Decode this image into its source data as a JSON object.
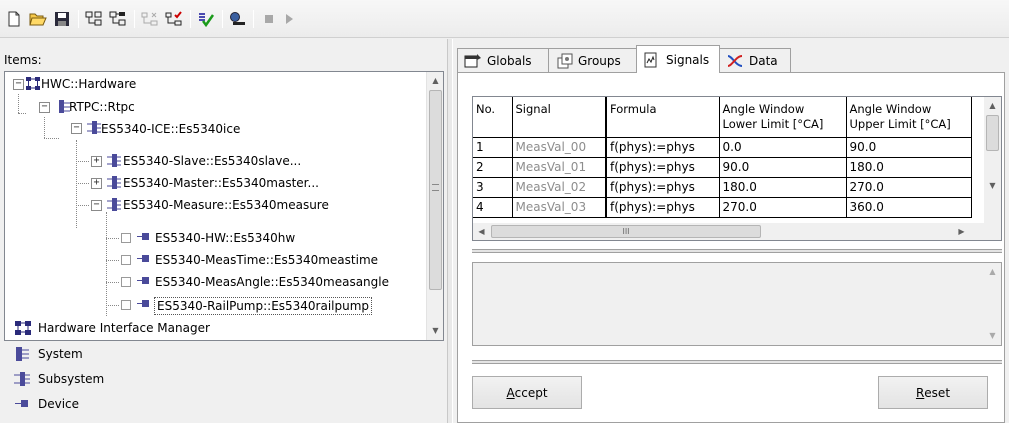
{
  "toolbar": {
    "buttons": [
      "new-icon",
      "open-icon",
      "save-icon",
      "tree-expand-icon",
      "tree-collapse-icon",
      "tree-disabled-icon",
      "tree-check-icon",
      "verify-icon",
      "connect-icon",
      "stop-icon",
      "run-icon"
    ]
  },
  "left": {
    "items_label": "Items:",
    "tree": [
      {
        "label": "HWC::Hardware",
        "level": 0,
        "type": "hardware",
        "expanded": true
      },
      {
        "label": "RTPC::Rtpc",
        "level": 1,
        "type": "system",
        "expanded": true
      },
      {
        "label": "ES5340-ICE::Es5340ice",
        "level": 2,
        "type": "subsystem",
        "expanded": true
      },
      {
        "label": "ES5340-Slave::Es5340slave...",
        "level": 3,
        "type": "subsystem",
        "expanded": false
      },
      {
        "label": "ES5340-Master::Es5340master...",
        "level": 3,
        "type": "subsystem",
        "expanded": false
      },
      {
        "label": "ES5340-Measure::Es5340measure",
        "level": 3,
        "type": "subsystem",
        "expanded": true
      },
      {
        "label": "ES5340-HW::Es5340hw",
        "level": 4,
        "type": "device"
      },
      {
        "label": "ES5340-MeasTime::Es5340meastime",
        "level": 4,
        "type": "device"
      },
      {
        "label": "ES5340-MeasAngle::Es5340measangle",
        "level": 4,
        "type": "device"
      },
      {
        "label": "ES5340-RailPump::Es5340railpump",
        "level": 4,
        "type": "device",
        "selected": true
      }
    ],
    "legend": [
      {
        "label": "Hardware Interface Manager",
        "icon": "hardware-icon"
      },
      {
        "label": "System",
        "icon": "system-icon"
      },
      {
        "label": "Subsystem",
        "icon": "subsystem-icon"
      },
      {
        "label": "Device",
        "icon": "device-icon"
      }
    ]
  },
  "right": {
    "tabs": [
      {
        "label": "Globals",
        "icon": "globals-icon",
        "active": false
      },
      {
        "label": "Groups",
        "icon": "groups-icon",
        "active": false
      },
      {
        "label": "Signals",
        "icon": "signals-icon",
        "active": true
      },
      {
        "label": "Data",
        "icon": "data-icon",
        "active": false
      }
    ],
    "grid": {
      "headers": [
        "No.",
        "Signal",
        "Formula",
        "Angle Window\nLower Limit [°CA]",
        "Angle Window\nUpper Limit [°CA]"
      ],
      "header_lines": [
        [
          "No."
        ],
        [
          "Signal"
        ],
        [
          "Formula"
        ],
        [
          "Angle Window",
          "Lower Limit [°CA]"
        ],
        [
          "Angle Window",
          "Upper Limit [°CA]"
        ]
      ],
      "rows": [
        [
          "1",
          "MeasVal_00",
          "f(phys):=phys",
          "0.0",
          "90.0"
        ],
        [
          "2",
          "MeasVal_01",
          "f(phys):=phys",
          "90.0",
          "180.0"
        ],
        [
          "3",
          "MeasVal_02",
          "f(phys):=phys",
          "180.0",
          "270.0"
        ],
        [
          "4",
          "MeasVal_03",
          "f(phys):=phys",
          "270.0",
          "360.0"
        ]
      ],
      "hscroll_glyph": "III"
    },
    "accept_label": "Accept",
    "accept_key": "A",
    "accept_rest": "ccept",
    "reset_label": "Reset",
    "reset_key": "R",
    "reset_rest": "eset"
  },
  "colors": {
    "window_bg": "#f0f0f0",
    "system_icon": "#4a4a9a",
    "hardware_icon": "#2a2a7a",
    "dim_text": "#8d8d8d"
  }
}
